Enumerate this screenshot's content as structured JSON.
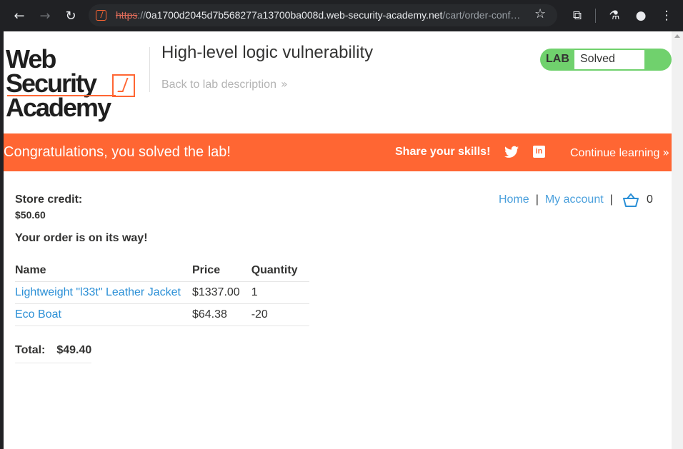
{
  "browser": {
    "url_scheme": "https",
    "url_sep": "://",
    "url_host": "0a1700d2045d7b568277a13700ba008d.web-security-academy.net",
    "url_path": "/cart/order-conf…",
    "back_glyph": "←",
    "forward_glyph": "→",
    "reload_glyph": "↻",
    "star_glyph": "☆",
    "extensions_glyph": "⧉",
    "labs_glyph": "⚗",
    "profile_glyph": "●",
    "menu_glyph": "⋮"
  },
  "header": {
    "logo_line1": "Web Security",
    "logo_line2": "Academy",
    "lab_title": "High-level logic vulnerability",
    "back_link": "Back to lab description",
    "chevron": "»",
    "status_tag": "LAB",
    "status_text": "Solved"
  },
  "banner": {
    "message": "Congratulations, you solved the lab!",
    "share_label": "Share your skills!",
    "linkedin_glyph": "in",
    "continue_label": "Continue learning",
    "chevron": "»"
  },
  "account": {
    "credit_label": "Store credit:",
    "credit_value": "$50.60",
    "order_message": "Your order is on its way!"
  },
  "nav": {
    "home": "Home",
    "pipe": "|",
    "my_account": "My account",
    "cart_count": "0"
  },
  "order": {
    "headers": [
      "Name",
      "Price",
      "Quantity"
    ],
    "rows": [
      {
        "name": "Lightweight \"l33t\" Leather Jacket",
        "price": "$1337.00",
        "quantity": "1"
      },
      {
        "name": "Eco Boat",
        "price": "$64.38",
        "quantity": "-20"
      }
    ],
    "total_label": "Total:",
    "total_value": "$49.40"
  },
  "colors": {
    "brand_orange": "#ff6633",
    "solved_green": "#70d16d",
    "link_blue": "#2a8fd6"
  }
}
